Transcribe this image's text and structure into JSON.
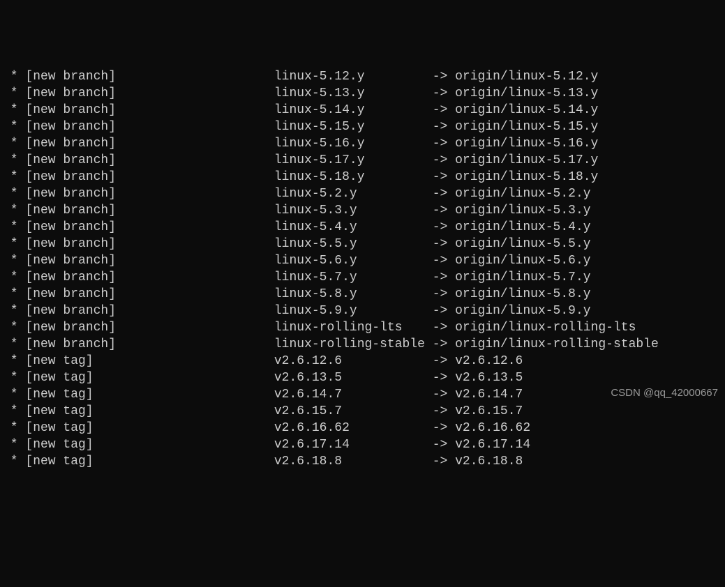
{
  "rows": [
    {
      "marker": " *",
      "type": "[new branch]",
      "name": "linux-5.12.y",
      "arrow": "->",
      "dest": "origin/linux-5.12.y"
    },
    {
      "marker": " *",
      "type": "[new branch]",
      "name": "linux-5.13.y",
      "arrow": "->",
      "dest": "origin/linux-5.13.y"
    },
    {
      "marker": " *",
      "type": "[new branch]",
      "name": "linux-5.14.y",
      "arrow": "->",
      "dest": "origin/linux-5.14.y"
    },
    {
      "marker": " *",
      "type": "[new branch]",
      "name": "linux-5.15.y",
      "arrow": "->",
      "dest": "origin/linux-5.15.y"
    },
    {
      "marker": " *",
      "type": "[new branch]",
      "name": "linux-5.16.y",
      "arrow": "->",
      "dest": "origin/linux-5.16.y"
    },
    {
      "marker": " *",
      "type": "[new branch]",
      "name": "linux-5.17.y",
      "arrow": "->",
      "dest": "origin/linux-5.17.y"
    },
    {
      "marker": " *",
      "type": "[new branch]",
      "name": "linux-5.18.y",
      "arrow": "->",
      "dest": "origin/linux-5.18.y"
    },
    {
      "marker": " *",
      "type": "[new branch]",
      "name": "linux-5.2.y",
      "arrow": "->",
      "dest": "origin/linux-5.2.y"
    },
    {
      "marker": " *",
      "type": "[new branch]",
      "name": "linux-5.3.y",
      "arrow": "->",
      "dest": "origin/linux-5.3.y"
    },
    {
      "marker": " *",
      "type": "[new branch]",
      "name": "linux-5.4.y",
      "arrow": "->",
      "dest": "origin/linux-5.4.y"
    },
    {
      "marker": " *",
      "type": "[new branch]",
      "name": "linux-5.5.y",
      "arrow": "->",
      "dest": "origin/linux-5.5.y"
    },
    {
      "marker": " *",
      "type": "[new branch]",
      "name": "linux-5.6.y",
      "arrow": "->",
      "dest": "origin/linux-5.6.y"
    },
    {
      "marker": " *",
      "type": "[new branch]",
      "name": "linux-5.7.y",
      "arrow": "->",
      "dest": "origin/linux-5.7.y"
    },
    {
      "marker": " *",
      "type": "[new branch]",
      "name": "linux-5.8.y",
      "arrow": "->",
      "dest": "origin/linux-5.8.y"
    },
    {
      "marker": " *",
      "type": "[new branch]",
      "name": "linux-5.9.y",
      "arrow": "->",
      "dest": "origin/linux-5.9.y"
    },
    {
      "marker": " *",
      "type": "[new branch]",
      "name": "linux-rolling-lts",
      "arrow": "->",
      "dest": "origin/linux-rolling-lts"
    },
    {
      "marker": " *",
      "type": "[new branch]",
      "name": "linux-rolling-stable",
      "arrow": "->",
      "dest": "origin/linux-rolling-stable"
    },
    {
      "marker": " *",
      "type": "[new tag]",
      "name": "v2.6.12.6",
      "arrow": "->",
      "dest": "v2.6.12.6"
    },
    {
      "marker": " *",
      "type": "[new tag]",
      "name": "v2.6.13.5",
      "arrow": "->",
      "dest": "v2.6.13.5"
    },
    {
      "marker": " *",
      "type": "[new tag]",
      "name": "v2.6.14.7",
      "arrow": "->",
      "dest": "v2.6.14.7"
    },
    {
      "marker": " *",
      "type": "[new tag]",
      "name": "v2.6.15.7",
      "arrow": "->",
      "dest": "v2.6.15.7"
    },
    {
      "marker": " *",
      "type": "[new tag]",
      "name": "v2.6.16.62",
      "arrow": "->",
      "dest": "v2.6.16.62"
    },
    {
      "marker": " *",
      "type": "[new tag]",
      "name": "v2.6.17.14",
      "arrow": "->",
      "dest": "v2.6.17.14"
    },
    {
      "marker": " *",
      "type": "[new tag]",
      "name": "v2.6.18.8",
      "arrow": "->",
      "dest": "v2.6.18.8"
    }
  ],
  "watermark": "CSDN @qq_42000667",
  "columns": {
    "col1_width": 36,
    "col2_width": 21
  }
}
